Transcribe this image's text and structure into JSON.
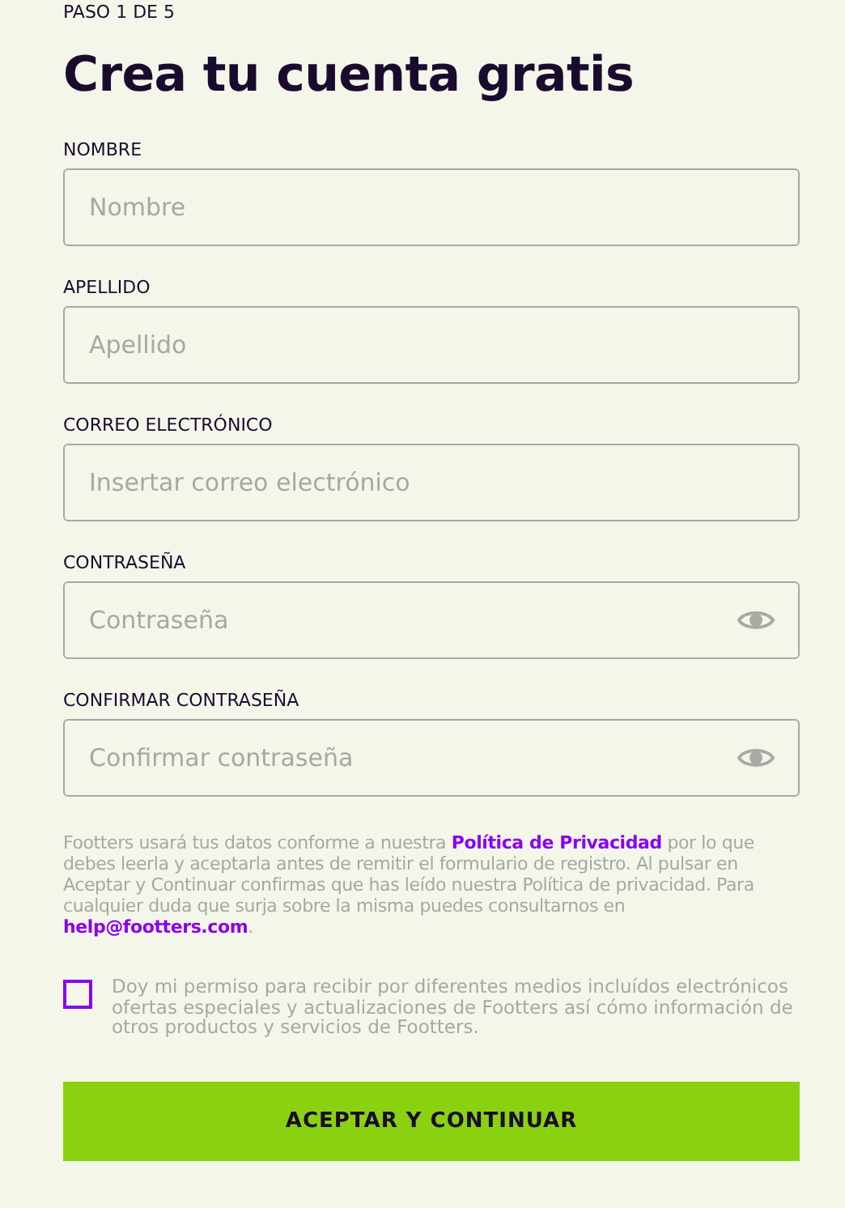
{
  "step": "PASO 1 DE 5",
  "title": "Crea tu cuenta gratis",
  "fields": [
    {
      "label": "NOMBRE",
      "placeholder": "Nombre",
      "kind": "text"
    },
    {
      "label": "APELLIDO",
      "placeholder": "Apellido",
      "kind": "text"
    },
    {
      "label": "CORREO ELECTRÓNICO",
      "placeholder": "Insertar correo electrónico",
      "kind": "text"
    },
    {
      "label": "CONTRASEÑA",
      "placeholder": "Contraseña",
      "kind": "password"
    },
    {
      "label": "CONFIRMAR CONTRASEÑA",
      "placeholder": "Confirmar contraseña",
      "kind": "password"
    }
  ],
  "privacy_notice": [
    {
      "kind": "text",
      "text": "Footters usará tus datos conforme a nuestra "
    },
    {
      "kind": "link",
      "text": "Política de Privacidad"
    },
    {
      "kind": "text",
      "text": " por lo que debes leerla y aceptarla antes de remitir el formulario de registro. Al pulsar en Aceptar y Continuar confirmas que has leído nuestra Política de privacidad. Para cualquier duda que surja sobre la misma puedes consultarnos en "
    },
    {
      "kind": "link",
      "text": "help@footters.com"
    },
    {
      "kind": "text",
      "text": "."
    }
  ],
  "consent": {
    "label": "Doy mi permiso para recibir por diferentes medios incluídos electrónicos ofertas especiales y actualizaciones de Footters así cómo información de otros productos y servicios de Footters.",
    "checked": false
  },
  "submit": "ACEPTAR Y CONTINUAR"
}
